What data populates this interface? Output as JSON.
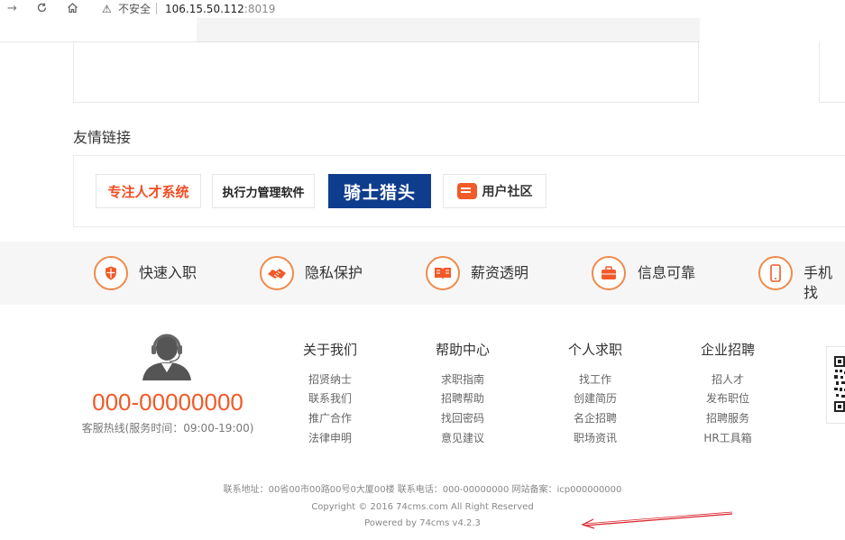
{
  "browser": {
    "back_icon": "arrow-right-icon",
    "reload_icon": "reload-icon",
    "home_icon": "home-icon",
    "security_warning": "不安全",
    "url_host": "106.15.50.112",
    "url_port": ":8019"
  },
  "links": {
    "title": "友情链接",
    "logos": [
      "专注人才系统",
      "执行力管理软件",
      "骑士猎头",
      "用户社区"
    ]
  },
  "features": [
    {
      "icon": "shield-icon",
      "label": "快速入职"
    },
    {
      "icon": "handshake-icon",
      "label": "隐私保护"
    },
    {
      "icon": "book-icon",
      "label": "薪资透明"
    },
    {
      "icon": "briefcase-icon",
      "label": "信息可靠"
    },
    {
      "icon": "phone-icon",
      "label": "手机找"
    }
  ],
  "support": {
    "phone": "000-00000000",
    "hours": "客服热线(服务时间：09:00-19:00)"
  },
  "footer_columns": [
    {
      "title": "关于我们",
      "links": [
        "招贤纳士",
        "联系我们",
        "推广合作",
        "法律申明"
      ]
    },
    {
      "title": "帮助中心",
      "links": [
        "求职指南",
        "招聘帮助",
        "找回密码",
        "意见建议"
      ]
    },
    {
      "title": "个人求职",
      "links": [
        "找工作",
        "创建简历",
        "名企招聘",
        "职场资讯"
      ]
    },
    {
      "title": "企业招聘",
      "links": [
        "招人才",
        "发布职位",
        "招聘服务",
        "HR工具箱"
      ]
    }
  ],
  "bottom": {
    "address": "联系地址：00省00市00路00号0大厦00楼 联系电话：000-00000000 网站备案：icp000000000",
    "copyright": "Copyright © 2016 74cms.com All Right Reserved",
    "powered": "Powered by 74cms v4.2.3"
  },
  "colors": {
    "accent": "#f05a28",
    "logo_blue": "#0f3d8e",
    "annotation_arrow": "#d9232a"
  }
}
